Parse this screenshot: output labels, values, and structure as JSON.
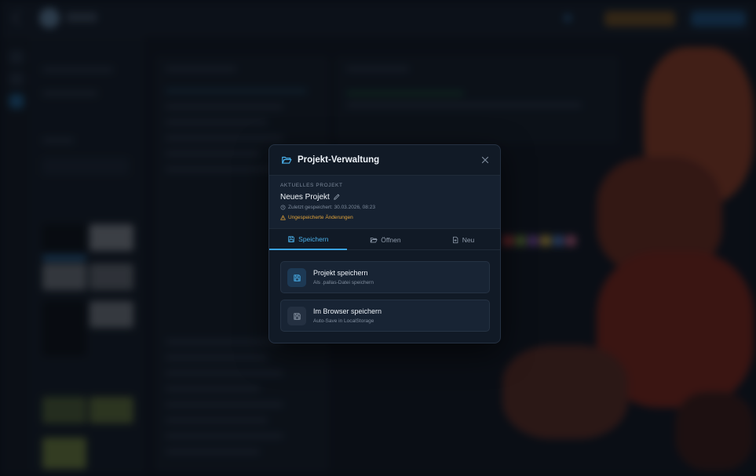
{
  "modal": {
    "title": "Projekt-Verwaltung",
    "title_icon": "folder-open-icon",
    "close_icon": "close-icon"
  },
  "project": {
    "section_label": "AKTUELLES PROJEKT",
    "name": "Neues Projekt",
    "last_saved": "Zuletzt gespeichert: 30.03.2026, 08:23",
    "unsaved_warning": "Ungespeicherte Änderungen"
  },
  "tabs": [
    {
      "label": "Speichern",
      "icon": "save-icon",
      "active": true
    },
    {
      "label": "Öffnen",
      "icon": "folder-icon",
      "active": false
    },
    {
      "label": "Neu",
      "icon": "new-file-icon",
      "active": false
    }
  ],
  "actions": [
    {
      "title": "Projekt speichern",
      "subtitle": "Als .pallas-Datei speichern",
      "icon": "save-icon"
    },
    {
      "title": "Im Browser speichern",
      "subtitle": "Auto-Save in LocalStorage",
      "icon": "save-icon"
    }
  ],
  "colors": {
    "accent": "#3aa3e0",
    "warning": "#e0a23a",
    "modal_bg": "#111a26"
  }
}
